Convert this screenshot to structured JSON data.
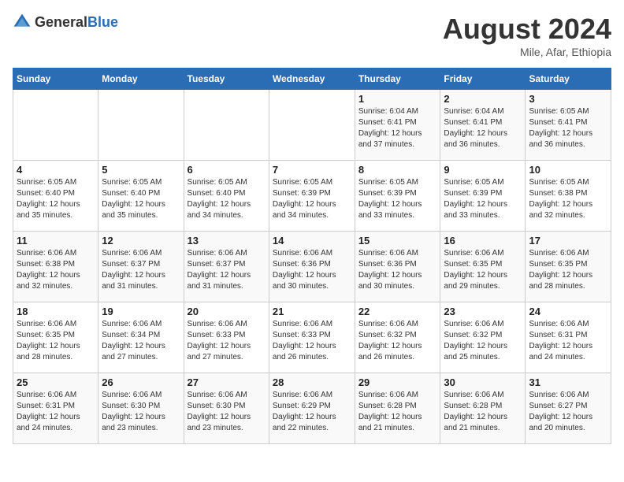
{
  "header": {
    "logo_general": "General",
    "logo_blue": "Blue",
    "title": "August 2024",
    "location": "Mile, Afar, Ethiopia"
  },
  "weekdays": [
    "Sunday",
    "Monday",
    "Tuesday",
    "Wednesday",
    "Thursday",
    "Friday",
    "Saturday"
  ],
  "weeks": [
    [
      {
        "day": "",
        "info": ""
      },
      {
        "day": "",
        "info": ""
      },
      {
        "day": "",
        "info": ""
      },
      {
        "day": "",
        "info": ""
      },
      {
        "day": "1",
        "info": "Sunrise: 6:04 AM\nSunset: 6:41 PM\nDaylight: 12 hours\nand 37 minutes."
      },
      {
        "day": "2",
        "info": "Sunrise: 6:04 AM\nSunset: 6:41 PM\nDaylight: 12 hours\nand 36 minutes."
      },
      {
        "day": "3",
        "info": "Sunrise: 6:05 AM\nSunset: 6:41 PM\nDaylight: 12 hours\nand 36 minutes."
      }
    ],
    [
      {
        "day": "4",
        "info": "Sunrise: 6:05 AM\nSunset: 6:40 PM\nDaylight: 12 hours\nand 35 minutes."
      },
      {
        "day": "5",
        "info": "Sunrise: 6:05 AM\nSunset: 6:40 PM\nDaylight: 12 hours\nand 35 minutes."
      },
      {
        "day": "6",
        "info": "Sunrise: 6:05 AM\nSunset: 6:40 PM\nDaylight: 12 hours\nand 34 minutes."
      },
      {
        "day": "7",
        "info": "Sunrise: 6:05 AM\nSunset: 6:39 PM\nDaylight: 12 hours\nand 34 minutes."
      },
      {
        "day": "8",
        "info": "Sunrise: 6:05 AM\nSunset: 6:39 PM\nDaylight: 12 hours\nand 33 minutes."
      },
      {
        "day": "9",
        "info": "Sunrise: 6:05 AM\nSunset: 6:39 PM\nDaylight: 12 hours\nand 33 minutes."
      },
      {
        "day": "10",
        "info": "Sunrise: 6:05 AM\nSunset: 6:38 PM\nDaylight: 12 hours\nand 32 minutes."
      }
    ],
    [
      {
        "day": "11",
        "info": "Sunrise: 6:06 AM\nSunset: 6:38 PM\nDaylight: 12 hours\nand 32 minutes."
      },
      {
        "day": "12",
        "info": "Sunrise: 6:06 AM\nSunset: 6:37 PM\nDaylight: 12 hours\nand 31 minutes."
      },
      {
        "day": "13",
        "info": "Sunrise: 6:06 AM\nSunset: 6:37 PM\nDaylight: 12 hours\nand 31 minutes."
      },
      {
        "day": "14",
        "info": "Sunrise: 6:06 AM\nSunset: 6:36 PM\nDaylight: 12 hours\nand 30 minutes."
      },
      {
        "day": "15",
        "info": "Sunrise: 6:06 AM\nSunset: 6:36 PM\nDaylight: 12 hours\nand 30 minutes."
      },
      {
        "day": "16",
        "info": "Sunrise: 6:06 AM\nSunset: 6:35 PM\nDaylight: 12 hours\nand 29 minutes."
      },
      {
        "day": "17",
        "info": "Sunrise: 6:06 AM\nSunset: 6:35 PM\nDaylight: 12 hours\nand 28 minutes."
      }
    ],
    [
      {
        "day": "18",
        "info": "Sunrise: 6:06 AM\nSunset: 6:35 PM\nDaylight: 12 hours\nand 28 minutes."
      },
      {
        "day": "19",
        "info": "Sunrise: 6:06 AM\nSunset: 6:34 PM\nDaylight: 12 hours\nand 27 minutes."
      },
      {
        "day": "20",
        "info": "Sunrise: 6:06 AM\nSunset: 6:33 PM\nDaylight: 12 hours\nand 27 minutes."
      },
      {
        "day": "21",
        "info": "Sunrise: 6:06 AM\nSunset: 6:33 PM\nDaylight: 12 hours\nand 26 minutes."
      },
      {
        "day": "22",
        "info": "Sunrise: 6:06 AM\nSunset: 6:32 PM\nDaylight: 12 hours\nand 26 minutes."
      },
      {
        "day": "23",
        "info": "Sunrise: 6:06 AM\nSunset: 6:32 PM\nDaylight: 12 hours\nand 25 minutes."
      },
      {
        "day": "24",
        "info": "Sunrise: 6:06 AM\nSunset: 6:31 PM\nDaylight: 12 hours\nand 24 minutes."
      }
    ],
    [
      {
        "day": "25",
        "info": "Sunrise: 6:06 AM\nSunset: 6:31 PM\nDaylight: 12 hours\nand 24 minutes."
      },
      {
        "day": "26",
        "info": "Sunrise: 6:06 AM\nSunset: 6:30 PM\nDaylight: 12 hours\nand 23 minutes."
      },
      {
        "day": "27",
        "info": "Sunrise: 6:06 AM\nSunset: 6:30 PM\nDaylight: 12 hours\nand 23 minutes."
      },
      {
        "day": "28",
        "info": "Sunrise: 6:06 AM\nSunset: 6:29 PM\nDaylight: 12 hours\nand 22 minutes."
      },
      {
        "day": "29",
        "info": "Sunrise: 6:06 AM\nSunset: 6:28 PM\nDaylight: 12 hours\nand 21 minutes."
      },
      {
        "day": "30",
        "info": "Sunrise: 6:06 AM\nSunset: 6:28 PM\nDaylight: 12 hours\nand 21 minutes."
      },
      {
        "day": "31",
        "info": "Sunrise: 6:06 AM\nSunset: 6:27 PM\nDaylight: 12 hours\nand 20 minutes."
      }
    ]
  ]
}
